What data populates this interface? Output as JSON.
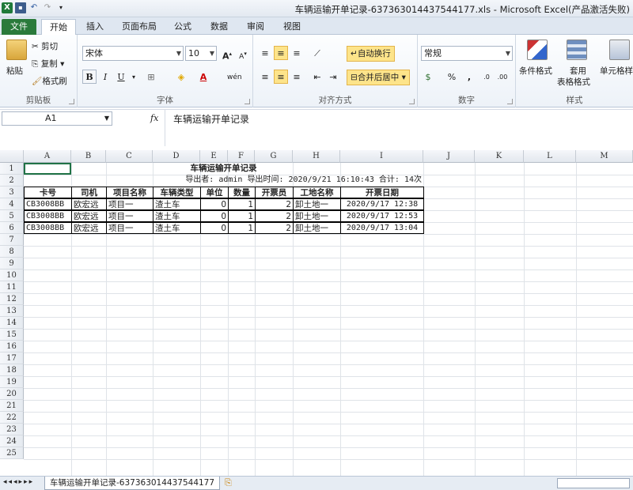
{
  "window": {
    "title": "车辆运输开单记录-637363014437544177.xls  -  Microsoft Excel(产品激活失败)"
  },
  "qat": {
    "icons": [
      "excel-icon",
      "save-icon",
      "undo-icon",
      "redo-icon",
      "customize-icon"
    ]
  },
  "tabs": [
    {
      "label": "文件"
    },
    {
      "label": "开始"
    },
    {
      "label": "插入"
    },
    {
      "label": "页面布局"
    },
    {
      "label": "公式"
    },
    {
      "label": "数据"
    },
    {
      "label": "审阅"
    },
    {
      "label": "视图"
    }
  ],
  "ribbon": {
    "clipboard": {
      "label": "剪贴板",
      "paste": "粘贴",
      "cut": "剪切",
      "copy": "复制",
      "format_painter": "格式刷"
    },
    "font": {
      "label": "字体",
      "font_name": "宋体",
      "font_size": "10",
      "bold": "B",
      "italic": "I",
      "underline": "U"
    },
    "alignment": {
      "label": "对齐方式",
      "wrap_text": "自动换行",
      "merge_center": "合并后居中"
    },
    "number": {
      "label": "数字",
      "format": "常规",
      "percent": "%",
      "comma": ","
    },
    "styles": {
      "label": "样式",
      "conditional": "条件格式",
      "table_style_1": "套用",
      "table_style_2": "表格格式",
      "cell_style": "单元格样"
    }
  },
  "formula_bar": {
    "name_box": "A1",
    "fx": "fx",
    "content": "车辆运输开单记录"
  },
  "columns": [
    "A",
    "B",
    "C",
    "D",
    "E",
    "F",
    "G",
    "H",
    "I",
    "J",
    "K",
    "L",
    "M"
  ],
  "rows": [
    "1",
    "2",
    "3",
    "4",
    "5",
    "6",
    "7",
    "8",
    "9",
    "10",
    "11",
    "12",
    "13",
    "14",
    "15",
    "16",
    "17",
    "18",
    "19",
    "20",
    "21",
    "22",
    "23",
    "24",
    "25"
  ],
  "sheet": {
    "title": "车辆运输开单记录",
    "subtitle": "导出者: admin 导出时间: 2020/9/21 16:10:43 合计: 14次",
    "headers": [
      "卡号",
      "司机",
      "项目名称",
      "车辆类型",
      "单位",
      "数量",
      "开票员",
      "工地名称",
      "开票日期"
    ],
    "rows": [
      [
        "CB3008BB",
        "欧宏远",
        "项目一",
        "渣土车",
        "0",
        "1",
        "2",
        "卸土地一",
        "2020/9/17 12:38"
      ],
      [
        "CB3008BB",
        "欧宏远",
        "项目一",
        "渣土车",
        "0",
        "1",
        "2",
        "卸土地一",
        "2020/9/17 12:53"
      ],
      [
        "CB3008BB",
        "欧宏远",
        "项目一",
        "渣土车",
        "0",
        "1",
        "2",
        "卸土地一",
        "2020/9/17 13:04"
      ]
    ]
  },
  "sheet_tabs": {
    "active": "车辆运输开单记录-637363014437544177"
  }
}
